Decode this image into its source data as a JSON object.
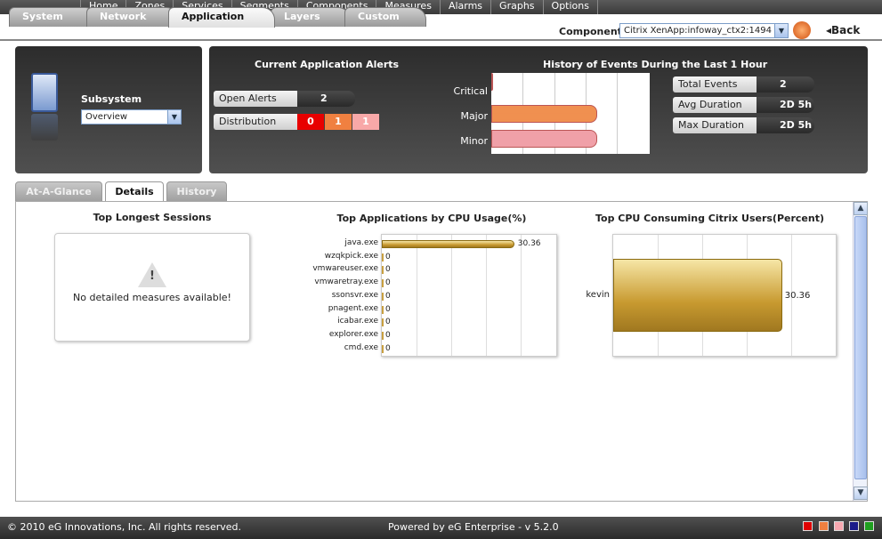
{
  "menu": {
    "items": [
      "Home",
      "Zones",
      "Services",
      "Segments",
      "Components",
      "Measures",
      "Alarms",
      "Graphs",
      "Options"
    ]
  },
  "tabs": [
    "System",
    "Network",
    "Application",
    "Layers",
    "Custom"
  ],
  "component": {
    "label": "Component",
    "value": "Citrix XenApp:infoway_ctx2:1494",
    "back": "Back"
  },
  "subsystem": {
    "label": "Subsystem",
    "value": "Overview"
  },
  "alerts": {
    "title": "Current Application Alerts",
    "open_label": "Open Alerts",
    "open_value": "2",
    "dist_label": "Distribution",
    "dist": [
      {
        "value": "0",
        "color": "#e80000"
      },
      {
        "value": "1",
        "color": "#f08040"
      },
      {
        "value": "1",
        "color": "#f8a8a8"
      }
    ]
  },
  "history": {
    "title": "History of Events During the Last 1 Hour",
    "rows": [
      {
        "label": "Critical",
        "value": "0",
        "fraction": 0,
        "color": "#e80000"
      },
      {
        "label": "Major",
        "value": "1",
        "fraction": 0.67,
        "color": "#f09050"
      },
      {
        "label": "Minor",
        "value": "1",
        "fraction": 0.67,
        "color": "#f0a0a8"
      }
    ]
  },
  "stats": [
    {
      "label": "Total Events",
      "value": "2"
    },
    {
      "label": "Avg Duration",
      "value": "2D 5h"
    },
    {
      "label": "Max Duration",
      "value": "2D 5h"
    }
  ],
  "subtabs": [
    "At-A-Glance",
    "Details",
    "History"
  ],
  "sessions": {
    "title": "Top Longest Sessions",
    "message": "No detailed measures available!"
  },
  "chart_data": [
    {
      "type": "bar",
      "title": "Top Applications by  CPU Usage(%)",
      "categories": [
        "java.exe",
        "wzqkpick.exe",
        "vmwareuser.exe",
        "vmwaretray.exe",
        "ssonsvr.exe",
        "pnagent.exe",
        "icabar.exe",
        "explorer.exe",
        "cmd.exe"
      ],
      "values": [
        30.36,
        0,
        0,
        0,
        0,
        0,
        0,
        0,
        0
      ],
      "value_labels": [
        "30.36",
        "0",
        "0",
        "0",
        "0",
        "0",
        "0",
        "0",
        "0"
      ],
      "xlim": [
        0,
        40
      ]
    },
    {
      "type": "bar",
      "title": "Top CPU Consuming Citrix Users(Percent)",
      "categories": [
        "kevin"
      ],
      "values": [
        30.36
      ],
      "value_labels": [
        "30.36"
      ],
      "xlim": [
        0,
        40
      ]
    }
  ],
  "footer": {
    "copyright": "© 2010 eG Innovations, Inc. All rights reserved.",
    "powered": "Powered by eG Enterprise  - v 5.2.0",
    "swatches": [
      "#e00000",
      "#f08040",
      "#f8a8b0",
      "#1a1a8a",
      "#20a020"
    ]
  }
}
